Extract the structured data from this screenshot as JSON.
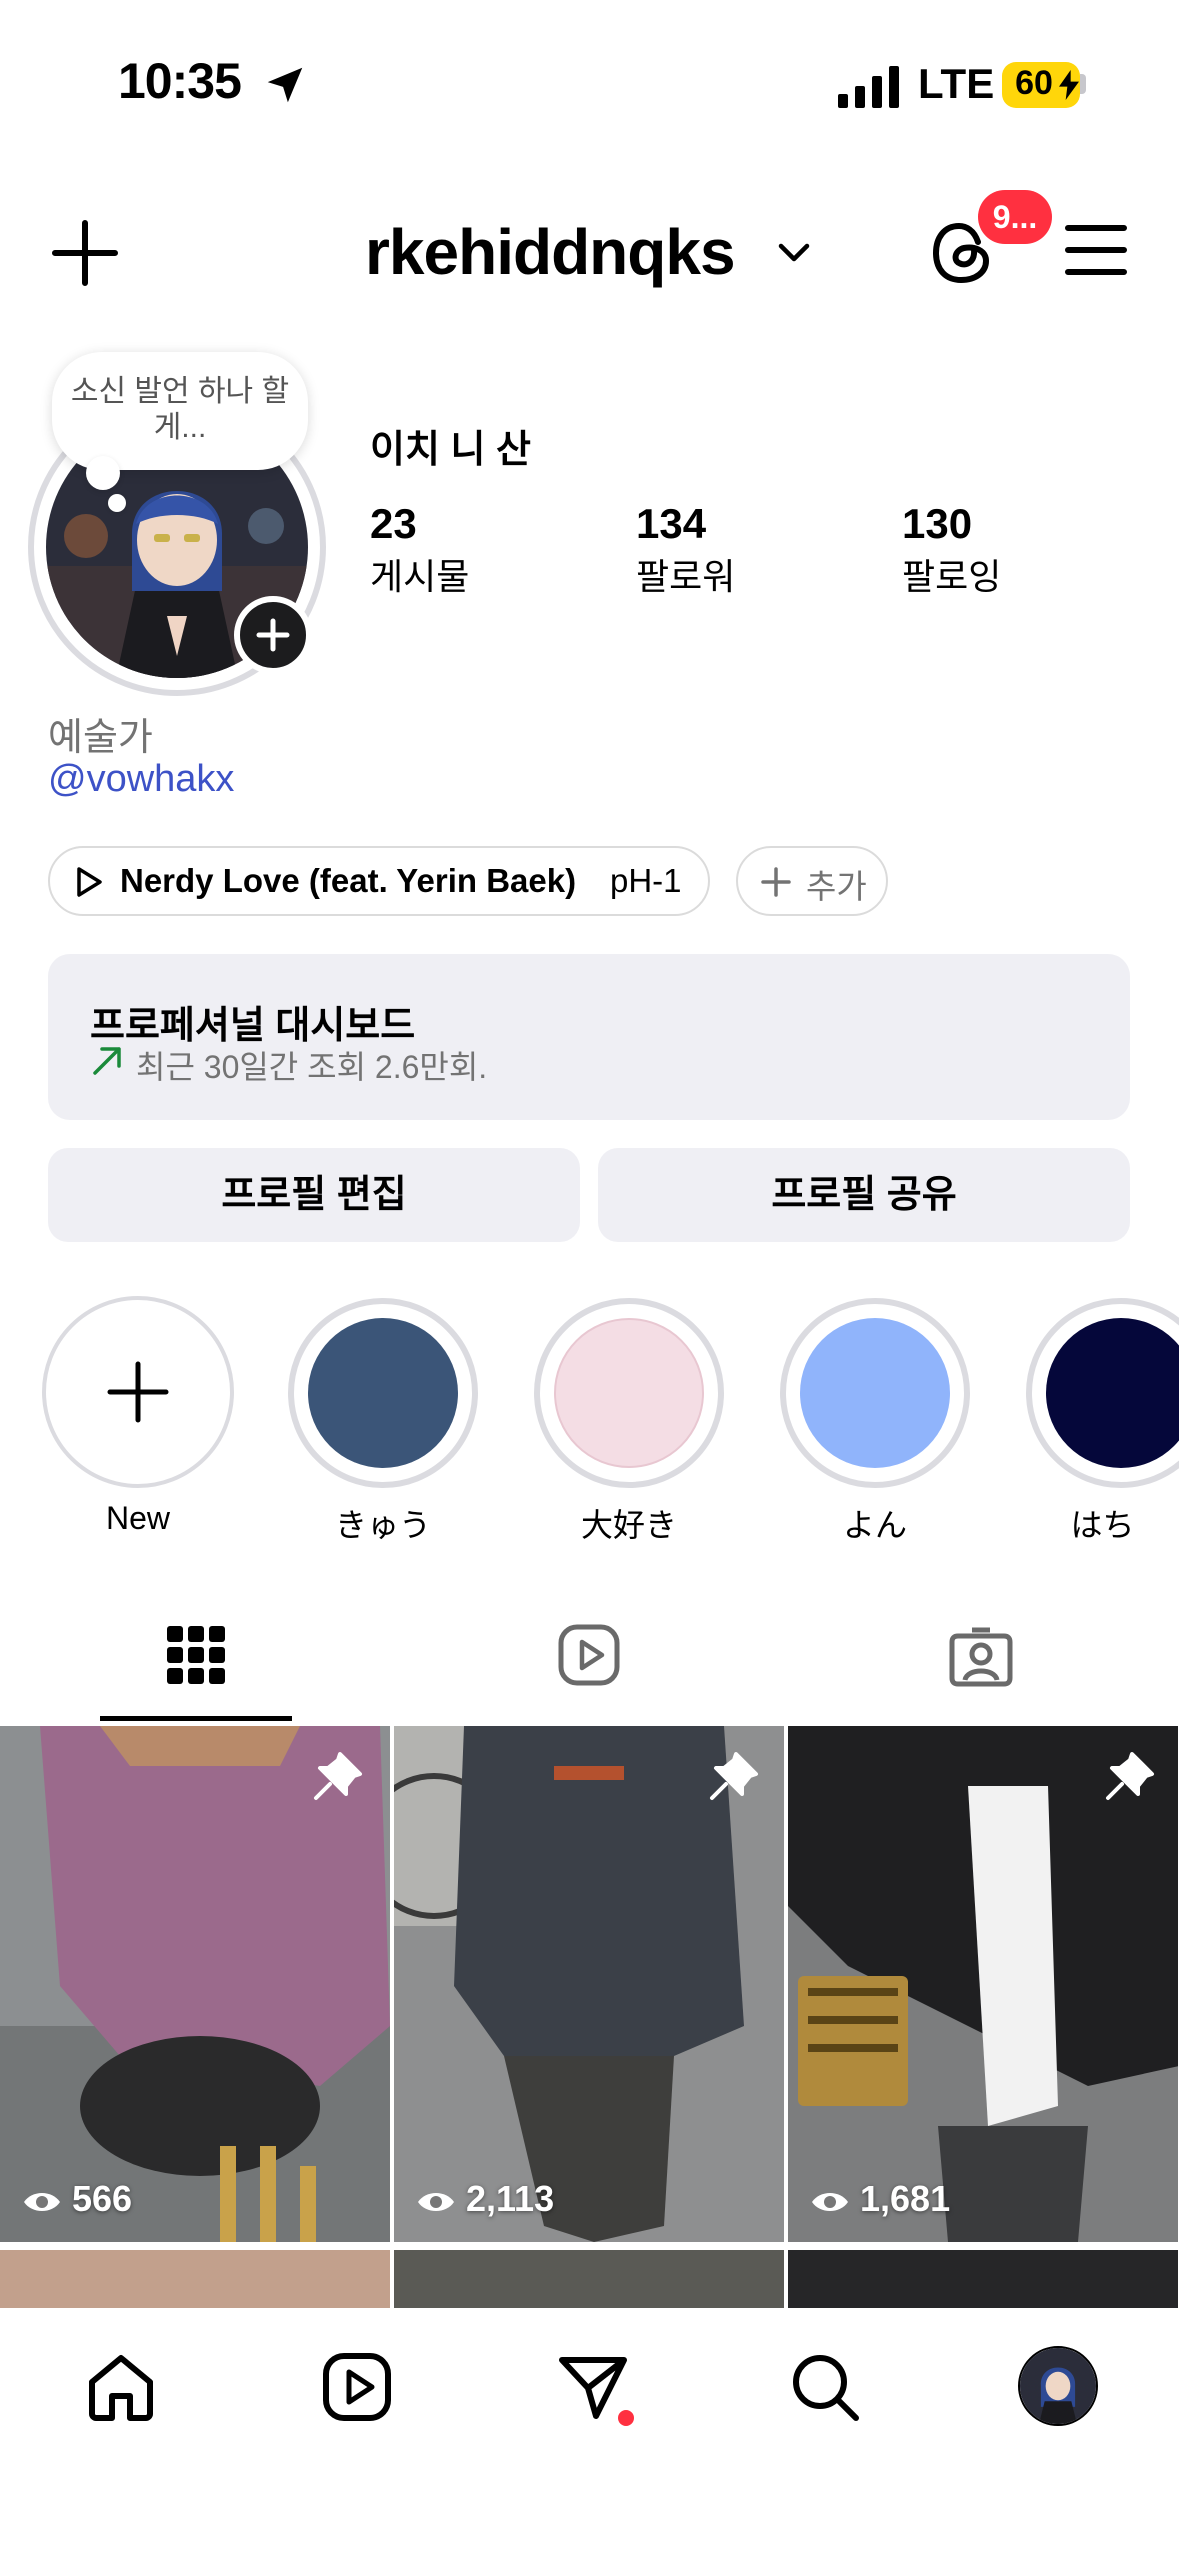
{
  "status_bar": {
    "time": "10:35",
    "network": "LTE",
    "battery": "60"
  },
  "header": {
    "username": "rkehiddnqks",
    "notification_badge": "9..."
  },
  "profile": {
    "note": "소신 발언 하나 할게...",
    "display_name": "이치 니 산",
    "stats": [
      {
        "value": "23",
        "label": "게시물"
      },
      {
        "value": "134",
        "label": "팔로워"
      },
      {
        "value": "130",
        "label": "팔로잉"
      }
    ],
    "category": "예술가",
    "handle": "@vowhakx"
  },
  "music": {
    "title": "Nerdy Love (feat. Yerin Baek)",
    "artist": "pH-1",
    "add_label": "추가"
  },
  "dashboard": {
    "title": "프로페셔널 대시보드",
    "subtitle": "최근 30일간 조회 2.6만회."
  },
  "buttons": {
    "edit": "프로필 편집",
    "share": "프로필 공유"
  },
  "highlights": [
    {
      "label": "New"
    },
    {
      "label": "きゅう",
      "color": "#3b5578"
    },
    {
      "label": "大好き",
      "color": "#f4dde4"
    },
    {
      "label": "よん",
      "color": "#90b4fb"
    },
    {
      "label": "はち",
      "color": "#05073a"
    }
  ],
  "posts": [
    {
      "views": "566",
      "pinned": true
    },
    {
      "views": "2,113",
      "pinned": true
    },
    {
      "views": "1,681",
      "pinned": true
    }
  ],
  "colors": {
    "accent_red": "#ff3040",
    "link_blue": "#3d52c7",
    "surface": "#efeff4"
  }
}
